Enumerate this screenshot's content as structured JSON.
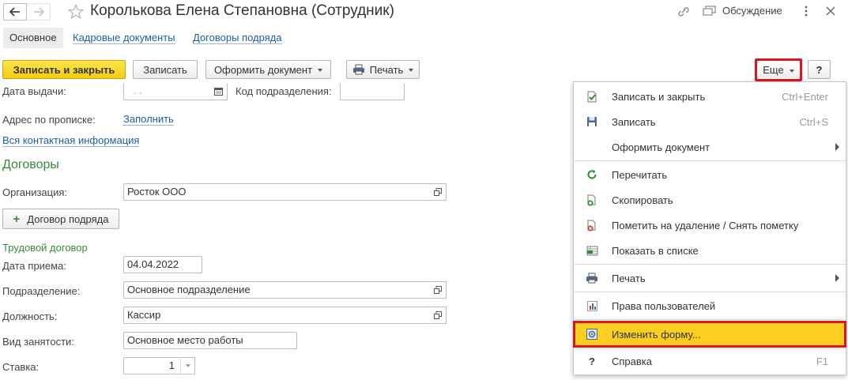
{
  "window": {
    "title": "Королькова Елена Степановна (Сотрудник)",
    "discussion_label": "Обсуждение"
  },
  "tabs": [
    {
      "label": "Основное",
      "active": true
    },
    {
      "label": "Кадровые документы",
      "active": false
    },
    {
      "label": "Договоры подряда",
      "active": false
    }
  ],
  "toolbar": {
    "save_close_label": "Записать и закрыть",
    "save_label": "Записать",
    "make_document_label": "Оформить документ",
    "print_label": "Печать",
    "more_label": "Еще",
    "help_label": "?"
  },
  "form": {
    "issue_date_label": "Дата выдачи:",
    "issue_date_value": ". .",
    "division_code_label": "Код подразделения:",
    "division_code_value": "",
    "registration_address_label": "Адрес по прописке:",
    "registration_address_link": "Заполнить",
    "all_contacts_link": "Вся контактная информация",
    "contracts_section": "Договоры",
    "organization_label": "Организация:",
    "organization_value": "Росток ООО",
    "add_contract_button": "Договор подряда",
    "labor_contract_section": "Трудовой договор",
    "hire_date_label": "Дата приема:",
    "hire_date_value": "04.04.2022",
    "department_label": "Подразделение:",
    "department_value": "Основное подразделение",
    "position_label": "Должность:",
    "position_value": "Кассир",
    "employment_type_label": "Вид занятости:",
    "employment_type_value": "Основное место работы",
    "rate_label": "Ставка:",
    "rate_value": "1"
  },
  "more_menu": {
    "items": [
      {
        "label": "Записать и закрыть",
        "shortcut": "Ctrl+Enter",
        "icon": "save-close-icon"
      },
      {
        "label": "Записать",
        "shortcut": "Ctrl+S",
        "icon": "floppy-disk-icon"
      },
      {
        "label": "Оформить документ",
        "shortcut": "",
        "icon": "",
        "submenu": true
      },
      {
        "label": "Перечитать",
        "shortcut": "",
        "icon": "refresh-icon"
      },
      {
        "label": "Скопировать",
        "shortcut": "",
        "icon": "copy-icon"
      },
      {
        "label": "Пометить на удаление / Снять пометку",
        "shortcut": "",
        "icon": "mark-delete-icon"
      },
      {
        "label": "Показать в списке",
        "shortcut": "",
        "icon": "show-in-list-icon"
      },
      {
        "label": "Печать",
        "shortcut": "",
        "icon": "printer-icon",
        "submenu": true
      },
      {
        "label": "Права пользователей",
        "shortcut": "",
        "icon": "user-rights-icon"
      },
      {
        "label": "Изменить форму...",
        "shortcut": "",
        "icon": "change-form-icon",
        "highlighted": true
      },
      {
        "label": "Справка",
        "shortcut": "F1",
        "icon": "help-icon"
      }
    ]
  },
  "colors": {
    "accent_yellow": "#f3cd12",
    "highlight_red": "#e0141f",
    "section_green": "#3a8a3a",
    "link_blue": "#1c5fa8"
  }
}
